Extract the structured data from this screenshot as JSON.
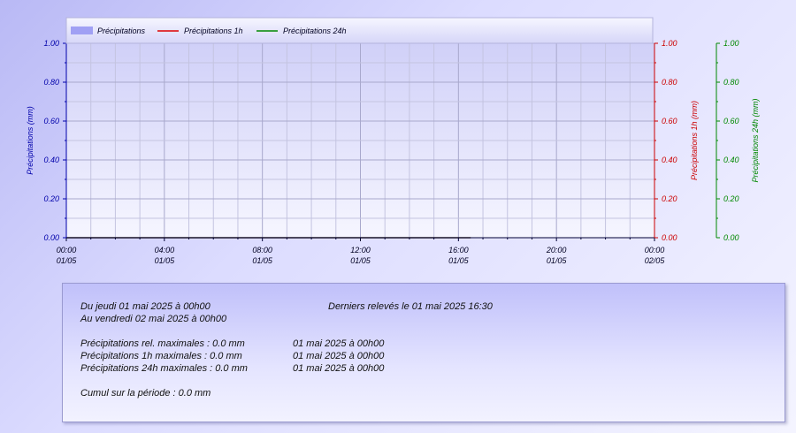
{
  "chart_data": {
    "type": "line",
    "legend": {
      "placement": "top",
      "entries": [
        {
          "label": "Précipitations",
          "color": "#a0a0f4",
          "kind": "area"
        },
        {
          "label": "Précipitations 1h",
          "color": "#dd0000",
          "kind": "line"
        },
        {
          "label": "Précipitations 24h",
          "color": "#008800",
          "kind": "line"
        }
      ]
    },
    "x_ticks": [
      {
        "time": "00:00",
        "date": "01/05"
      },
      {
        "time": "04:00",
        "date": "01/05"
      },
      {
        "time": "08:00",
        "date": "01/05"
      },
      {
        "time": "12:00",
        "date": "01/05"
      },
      {
        "time": "16:00",
        "date": "01/05"
      },
      {
        "time": "20:00",
        "date": "01/05"
      },
      {
        "time": "00:00",
        "date": "02/05"
      }
    ],
    "x_range_hours": [
      0,
      24
    ],
    "grid": true,
    "axes": [
      {
        "label": "Précipitations (mm)",
        "side": "left",
        "color": "#0000aa",
        "ylim": [
          0,
          1
        ],
        "ticks": [
          "0.00",
          "0.20",
          "0.40",
          "0.60",
          "0.80",
          "1.00"
        ]
      },
      {
        "label": "Précipitations 1h (mm)",
        "side": "right",
        "color": "#cc0000",
        "ylim": [
          0,
          1
        ],
        "ticks": [
          "0.00",
          "0.20",
          "0.40",
          "0.60",
          "0.80",
          "1.00"
        ]
      },
      {
        "label": "Précipitations 24h (mm)",
        "side": "far-right",
        "color": "#008800",
        "ylim": [
          0,
          1
        ],
        "ticks": [
          "0.00",
          "0.20",
          "0.40",
          "0.60",
          "0.80",
          "1.00"
        ]
      }
    ],
    "series": [
      {
        "name": "Précipitations",
        "x_hours": [
          0,
          16.5
        ],
        "values": [
          0,
          0
        ]
      },
      {
        "name": "Précipitations 1h",
        "x_hours": [
          0,
          16.5
        ],
        "values": [
          0,
          0
        ]
      },
      {
        "name": "Précipitations 24h",
        "x_hours": [
          0,
          16.5
        ],
        "values": [
          0,
          0
        ]
      }
    ]
  },
  "info": {
    "period_from": "Du jeudi 01 mai 2025 à 00h00",
    "period_to": "Au vendredi 02 mai 2025 à 00h00",
    "last_reading": "Derniers relevés le 01 mai 2025 16:30",
    "rel_max_label": "Précipitations rel. maximales : 0.0 mm",
    "rel_max_date": "01 mai 2025 à 00h00",
    "h1_max_label": "Précipitations 1h maximales : 0.0 mm",
    "h1_max_date": "01 mai 2025 à 00h00",
    "h24_max_label": "Précipitations 24h maximales : 0.0 mm",
    "h24_max_date": "01 mai 2025 à 00h00",
    "cumul": "Cumul sur la période : 0.0 mm"
  }
}
